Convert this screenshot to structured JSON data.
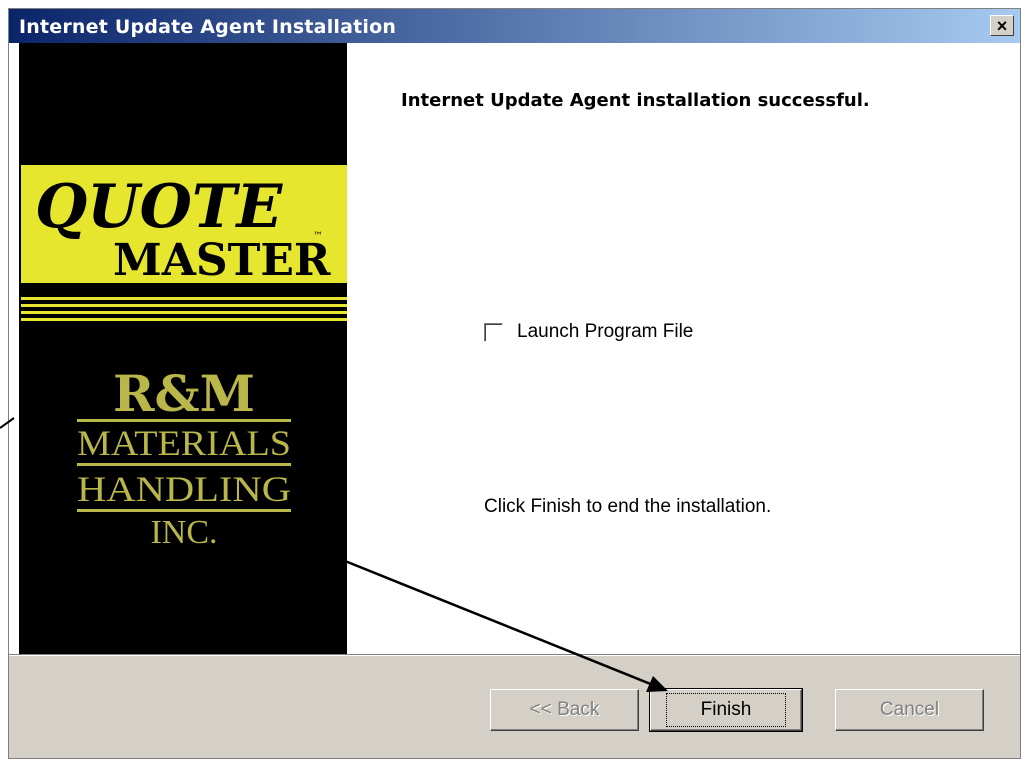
{
  "window": {
    "title": "Internet Update Agent Installation",
    "close_glyph": "×"
  },
  "side_panel": {
    "quote_master_logo": {
      "line1": "QUOTE",
      "line2": "MASTER",
      "tm": "™"
    },
    "rm_logo": {
      "line1": "R&M",
      "line2": "MATERIALS",
      "line3": "HANDLING",
      "line4": "INC."
    }
  },
  "main": {
    "heading": "Internet Update Agent installation successful.",
    "launch_checkbox": {
      "label": "Launch Program File",
      "checked": false
    },
    "hint": "Click Finish to end the installation."
  },
  "buttons": {
    "back": {
      "label": "<< Back",
      "enabled": false
    },
    "finish": {
      "label": "Finish",
      "enabled": true
    },
    "cancel": {
      "label": "Cancel",
      "enabled": false
    }
  },
  "colors": {
    "titlebar_start": "#0a246a",
    "titlebar_end": "#a6caf0",
    "logo_yellow": "#e6e62e",
    "dialog_face": "#d4d0c8"
  },
  "icons": [
    "close-icon",
    "checkbox-icon",
    "annotation-arrow"
  ]
}
